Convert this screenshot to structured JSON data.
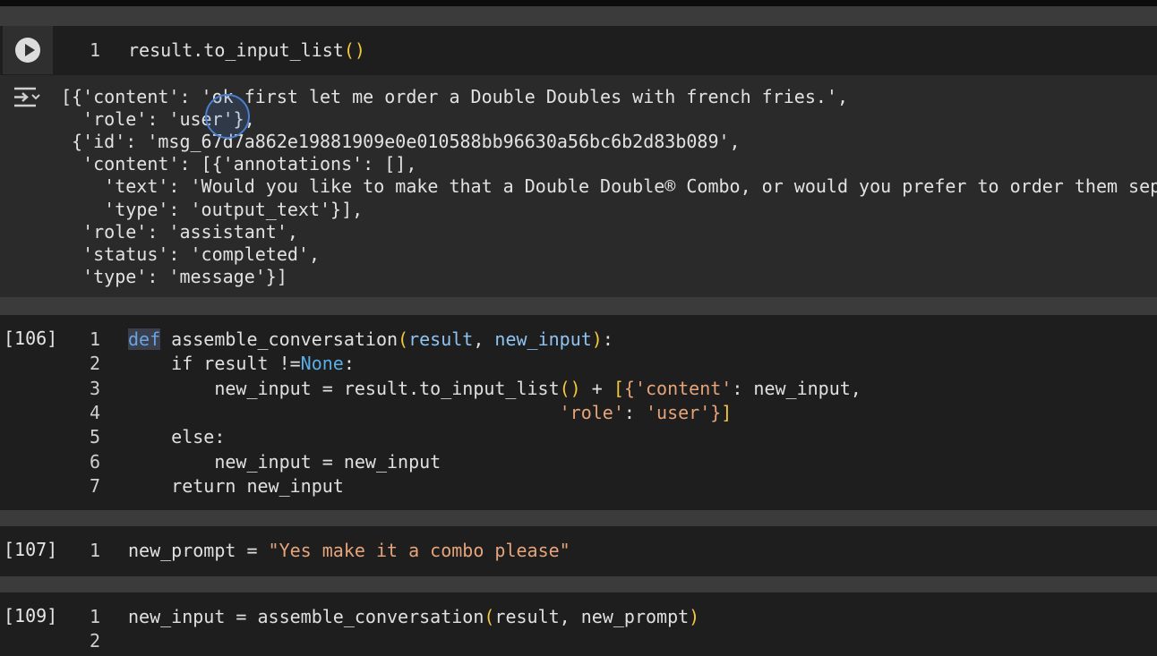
{
  "cells": [
    {
      "exec": "",
      "lines": [
        {
          "n": "1",
          "parts": [
            [
              "default",
              "result.to_input_list"
            ],
            [
              "brk",
              "()"
            ]
          ]
        }
      ]
    },
    {
      "exec": "[106]",
      "lines": [
        {
          "n": "1",
          "parts": [
            [
              "kwhl",
              "def"
            ],
            [
              "default",
              " assemble_conversation"
            ],
            [
              "brk",
              "("
            ],
            [
              "param",
              "result"
            ],
            [
              "default",
              ", "
            ],
            [
              "param",
              "new_input"
            ],
            [
              "brk",
              ")"
            ],
            [
              "default",
              ":"
            ]
          ]
        },
        {
          "n": "2",
          "parts": [
            [
              "default",
              "    if result !="
            ],
            [
              "const",
              "None"
            ],
            [
              "default",
              ":"
            ]
          ]
        },
        {
          "n": "3",
          "parts": [
            [
              "default",
              "        new_input = result.to_input_list"
            ],
            [
              "brk",
              "()"
            ],
            [
              "default",
              " + "
            ],
            [
              "brk",
              "["
            ],
            [
              "brk2",
              "{"
            ],
            [
              "str",
              "'content'"
            ],
            [
              "default",
              ": new_input,"
            ]
          ]
        },
        {
          "n": "4",
          "parts": [
            [
              "default",
              "                                        "
            ],
            [
              "str",
              "'role'"
            ],
            [
              "default",
              ": "
            ],
            [
              "str",
              "'user'"
            ],
            [
              "brk2",
              "}"
            ],
            [
              "brk",
              "]"
            ]
          ]
        },
        {
          "n": "5",
          "parts": [
            [
              "default",
              "    else:"
            ]
          ]
        },
        {
          "n": "6",
          "parts": [
            [
              "default",
              "        new_input = new_input"
            ]
          ]
        },
        {
          "n": "7",
          "parts": [
            [
              "default",
              "    return new_input"
            ]
          ]
        }
      ]
    },
    {
      "exec": "[107]",
      "lines": [
        {
          "n": "1",
          "parts": [
            [
              "default",
              "new_prompt = "
            ],
            [
              "str",
              "\"Yes make it a combo please\""
            ]
          ]
        }
      ]
    },
    {
      "exec": "[109]",
      "lines": [
        {
          "n": "1",
          "parts": [
            [
              "default",
              "new_input = assemble_conversation"
            ],
            [
              "brk",
              "("
            ],
            [
              "default",
              "result, new_prompt"
            ],
            [
              "brk",
              ")"
            ]
          ]
        },
        {
          "n": "2",
          "parts": []
        }
      ]
    }
  ],
  "output": [
    "[{'content': 'ok first let me order a Double Doubles with french fries.',",
    "  'role': 'user'},",
    " {'id': 'msg_67d7a862e19881909e0e010588bb96630a56bc6b2d83b089',",
    "  'content': [{'annotations': [],",
    "    'text': 'Would you like to make that a Double Double® Combo, or would you prefer to order them sep",
    "    'type': 'output_text'}],",
    "  'role': 'assistant',",
    "  'status': 'completed',",
    "  'type': 'message'}]"
  ],
  "icons": {
    "run": "play-circle-icon",
    "output": "output-collapse-icon"
  }
}
